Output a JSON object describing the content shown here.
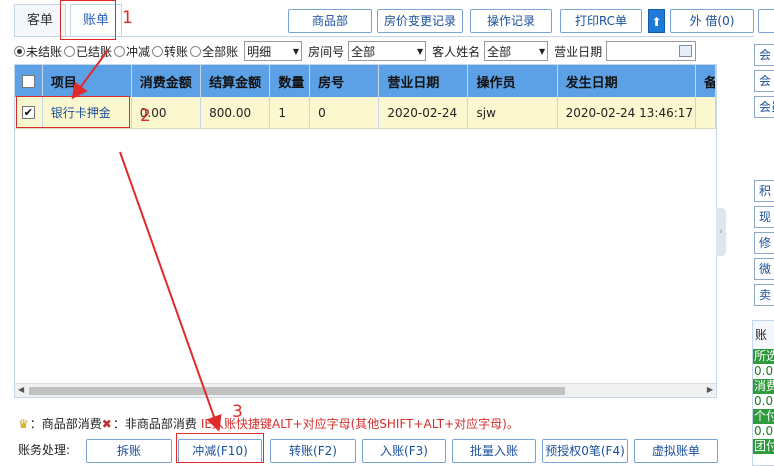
{
  "tabs": [
    {
      "label": "客单"
    },
    {
      "label": "账单"
    }
  ],
  "toolbar": {
    "b1": "商品部",
    "b2": "房价变更记录",
    "b3": "操作记录",
    "b4": "打印RC单",
    "up": "⬆",
    "b5": "外 借(0)"
  },
  "filters": {
    "radios": [
      "未结账",
      "已结账",
      "冲减",
      "转账",
      "全部账"
    ],
    "detail_value": "明细",
    "room_label": "房间号",
    "room_value": "全部",
    "guest_label": "客人姓名",
    "guest_value": "全部",
    "date_label": "营业日期",
    "date_value": ""
  },
  "grid": {
    "columns": [
      "项目",
      "消费金额",
      "结算金额",
      "数量",
      "房号",
      "营业日期",
      "操作员",
      "发生日期",
      "备"
    ],
    "rows": [
      {
        "item": "银行卡押金",
        "consume": "0.00",
        "settle": "800.00",
        "qty": "1",
        "room": "0",
        "bizdate": "2020-02-24",
        "operator": "sjw",
        "occurred": "2020-02-24 13:46:17",
        "extra": ""
      }
    ]
  },
  "right_panel": {
    "buttons": [
      "会",
      "会",
      "会员",
      "积",
      "现",
      "修",
      "微",
      "卖"
    ],
    "header": "账",
    "lines": [
      {
        "label": "所选",
        "value": "0.0"
      },
      {
        "label": "消费",
        "value": "0.0"
      },
      {
        "label": "个付",
        "value": "0.0"
      },
      {
        "label": "团付",
        "value": ""
      }
    ]
  },
  "legend": {
    "goods": "：商品部消费",
    "non_goods": "：非商品部消费",
    "hint": "IE入账快捷键ALT+对应字母(其他SHIFT+ALT+对应字母)。"
  },
  "actions": {
    "label": "账务处理:",
    "buttons": [
      "拆账",
      "冲减(F10)",
      "转账(F2)",
      "入账(F3)",
      "批量入账",
      "预授权0笔(F4)",
      "虚拟账单"
    ]
  },
  "annotations": {
    "n1": "1",
    "n2": "2",
    "n3": "3"
  },
  "colors": {
    "accent": "#5ca1e6",
    "row_highlight": "#fbf7cf",
    "annotation": "#e02b2b"
  }
}
